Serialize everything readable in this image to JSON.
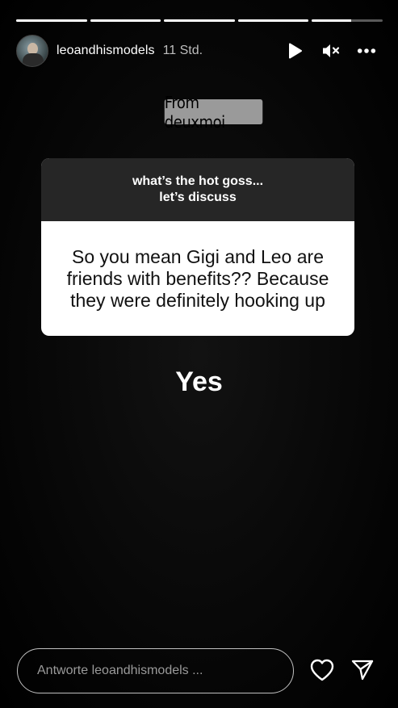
{
  "story": {
    "progress": [
      1,
      1,
      1,
      1,
      0.55
    ],
    "user": {
      "username": "leoandhismodels",
      "time": "11 Std."
    },
    "icons": {
      "play": "play-icon",
      "mute": "mute-icon",
      "more": "more-icon"
    }
  },
  "source_tag": "From deuxmoi",
  "question_sticker": {
    "prompt_line1": "what’s the hot goss...",
    "prompt_line2": "let’s discuss",
    "question_line1": "So you mean Gigi and Leo are",
    "question_line2": "friends with benefits?? Because",
    "question_line3": "they were definitely hooking up"
  },
  "answer": "Yes",
  "reply_bar": {
    "placeholder": "Antworte leoandhismodels ...",
    "like_icon": "heart-icon",
    "send_icon": "send-icon"
  }
}
